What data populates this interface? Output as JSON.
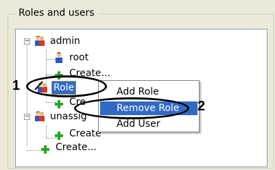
{
  "groupbox": {
    "title": "Roles and users"
  },
  "tree": {
    "nodes": [
      {
        "label": "admin",
        "icon": "users-group-icon"
      },
      {
        "label": "root",
        "icon": "user-icon"
      },
      {
        "label": "Create...",
        "icon": "plus-icon"
      },
      {
        "label": "Role",
        "icon": "users-group-icon",
        "selected": true
      },
      {
        "label": "Cre",
        "icon": "plus-icon"
      },
      {
        "label": "unassig",
        "icon": "users-group-icon"
      },
      {
        "label": "Create",
        "icon": "plus-icon"
      },
      {
        "label": "Create...",
        "icon": "plus-icon"
      }
    ]
  },
  "context_menu": {
    "items": [
      "Add Role",
      "Remove Role",
      "Add User"
    ],
    "highlighted": "Remove Role"
  },
  "annotations": {
    "marker1": "1",
    "marker2": "2"
  },
  "colors": {
    "selection": "#316AC5",
    "plus_green": "#22A822",
    "background": "#ECE9D8"
  }
}
